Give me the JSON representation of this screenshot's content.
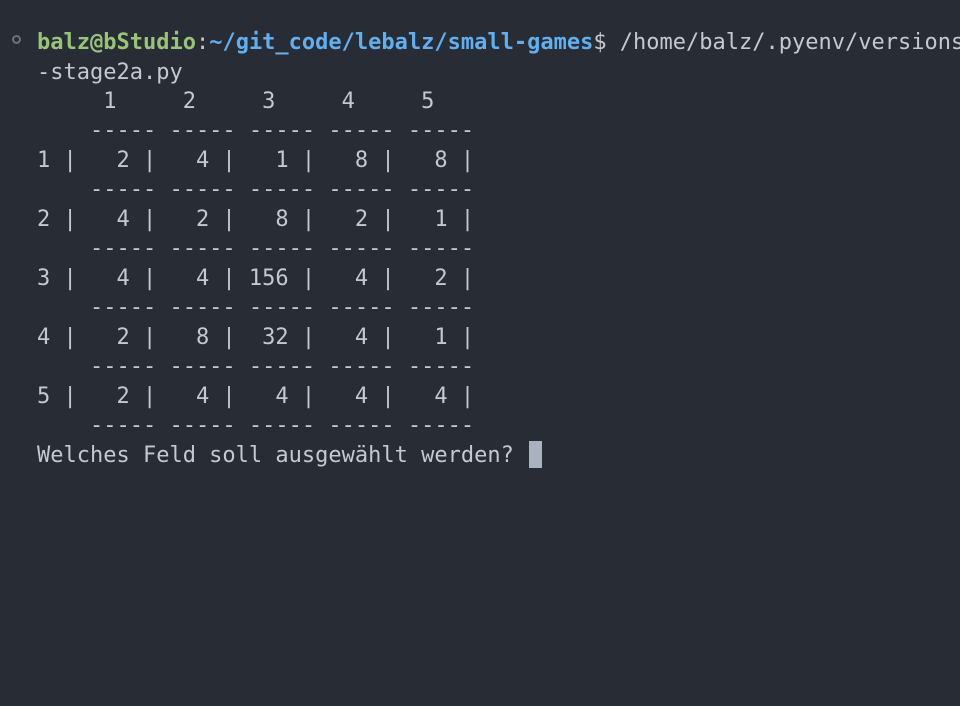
{
  "prompt": {
    "user_host": "balz@bStudio",
    "colon": ":",
    "path": "~/git_code/lebalz/small-games",
    "dollar": "$",
    "command": " /home/balz/.pyenv/versions",
    "command_wrap": "-stage2a.py"
  },
  "board": {
    "header": "     1     2     3     4     5",
    "separator": "    ----- ----- ----- ----- -----",
    "rows": [
      "1 |   2 |   4 |   1 |   8 |   8 |",
      "2 |   4 |   2 |   8 |   2 |   1 |",
      "3 |   4 |   4 | 156 |   4 |   2 |",
      "4 |   2 |   8 |  32 |   4 |   1 |",
      "5 |   2 |   4 |   4 |   4 |   4 |"
    ]
  },
  "question": "Welches Feld soll ausgewählt werden? ",
  "icons": {
    "status_dot": "circle-outline-icon",
    "cursor": "block-cursor"
  },
  "colors": {
    "background": "#282c34",
    "text": "#c4c8d0",
    "user_host": "#98c379",
    "path": "#61afef",
    "cursor": "#abb2bf"
  }
}
